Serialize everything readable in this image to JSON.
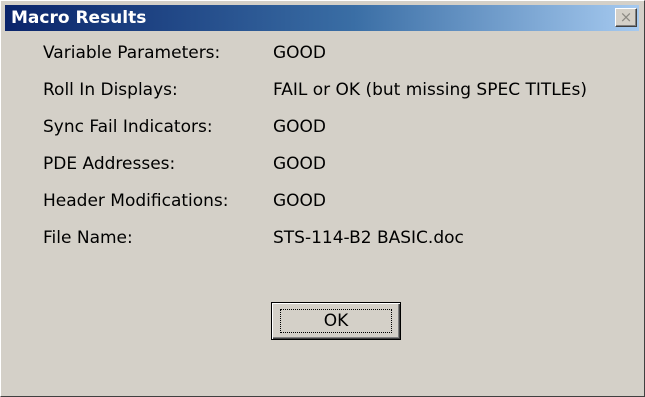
{
  "window": {
    "title": "Macro Results",
    "close_label": "×"
  },
  "results": [
    {
      "label": "Variable Parameters:",
      "value": "GOOD"
    },
    {
      "label": "Roll In Displays:",
      "value": "FAIL or OK (but missing SPEC TITLEs)"
    },
    {
      "label": "Sync Fail Indicators:",
      "value": "GOOD"
    },
    {
      "label": "PDE Addresses:",
      "value": "GOOD"
    },
    {
      "label": "Header Modifications:",
      "value": "GOOD"
    },
    {
      "label": "File Name:",
      "value": "STS-114-B2 BASIC.doc"
    }
  ],
  "buttons": {
    "ok_label": "OK"
  },
  "colors": {
    "titlebar_start": "#0a246a",
    "titlebar_end": "#a6caf0",
    "dialog_background": "#d4d0c8"
  }
}
